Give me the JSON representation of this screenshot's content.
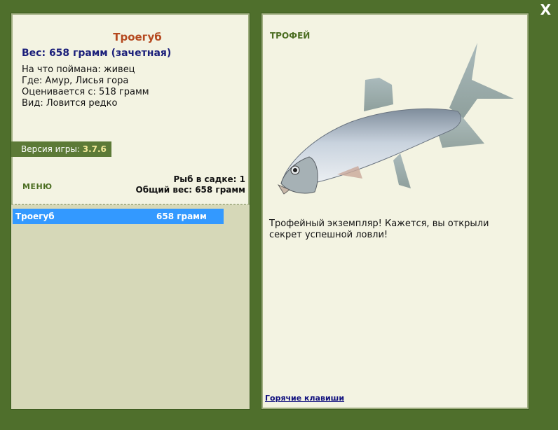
{
  "fish": {
    "name": "Троегуб",
    "weight_line": "Вес: 658 грамм (зачетная)",
    "bait": "На что поймана: живец",
    "location": "Где: Амур, Лисья гора",
    "threshold": "Оценивается с: 518 грамм",
    "kind": "Вид: Ловится редко"
  },
  "version": {
    "label": "Версия игры:",
    "value": "3.7.6"
  },
  "menu_label": "МЕНЮ",
  "stats": {
    "count": "Рыб в садке: 1",
    "total": "Общий вес: 658 грамм"
  },
  "catch_list": [
    {
      "name": "Троегуб",
      "weight": "658 грамм"
    }
  ],
  "right": {
    "trophy": "ТРОФЕЙ",
    "description": "Трофейный экземпляр! Кажется, вы открыли секрет успешной ловли!",
    "hotkeys": "Горячие клавиши"
  },
  "close_label": "X",
  "colors": {
    "frame": "#4f6f2c",
    "panel": "#f3f3e2",
    "title": "#b5491f",
    "weight": "#1a1e7a",
    "selection": "#3399ff"
  }
}
